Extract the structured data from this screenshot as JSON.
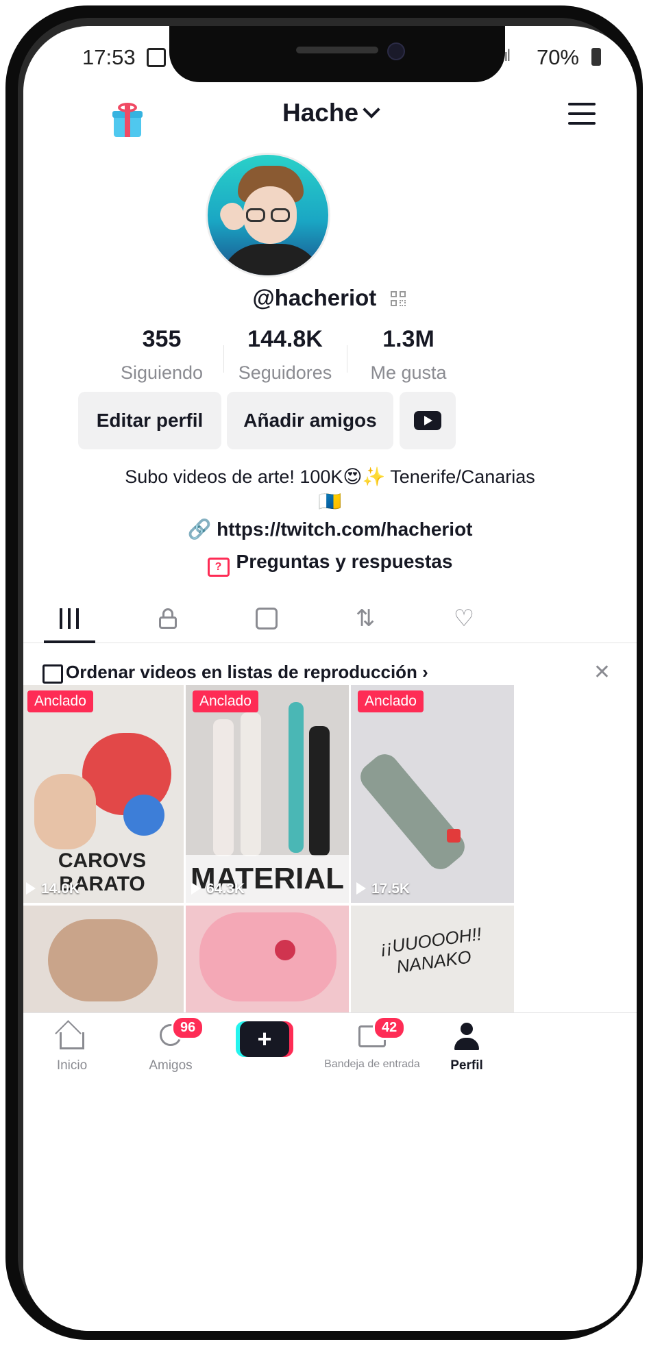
{
  "status_bar": {
    "time": "17:53",
    "battery": "70%",
    "signal": "·ıl"
  },
  "header": {
    "username_title": "Hache"
  },
  "profile": {
    "handle": "@hacheriot",
    "stats": [
      {
        "value": "355",
        "label": "Siguiendo"
      },
      {
        "value": "144.8K",
        "label": "Seguidores"
      },
      {
        "value": "1.3M",
        "label": "Me gusta"
      }
    ],
    "buttons": {
      "edit": "Editar perfil",
      "add_friends": "Añadir amigos"
    },
    "bio_line1": "Subo videos de arte! 100K😍✨ Tenerife/Canarias",
    "bio_line2": "🇮🇨",
    "link": "https://twitch.com/hacheriot",
    "qa": "Preguntas y respuestas"
  },
  "playlist_banner": "Ordenar videos en listas de reproducción",
  "videos": [
    {
      "badge": "Anclado",
      "views": "14.0K",
      "caption": "CAROVS BARATO",
      "bg": "#e9e6e2"
    },
    {
      "badge": "Anclado",
      "views": "64.3K",
      "caption": "MATERIAL",
      "bg": "#d7d4d2"
    },
    {
      "badge": "Anclado",
      "views": "17.5K",
      "caption": "",
      "bg": "#dddce0"
    },
    {
      "badge": "",
      "views": "",
      "caption": "",
      "bg": "#e4dcd6"
    },
    {
      "badge": "",
      "views": "",
      "caption": "",
      "bg": "#f2c6cc"
    },
    {
      "badge": "",
      "views": "",
      "caption": "¡¡UUOOOH!! NANAKO",
      "bg": "#ebe9e6"
    }
  ],
  "bottom_nav": {
    "home": "Inicio",
    "friends": "Amigos",
    "friends_badge": "96",
    "create": "+",
    "inbox": "Bandeja de entrada",
    "inbox_badge": "42",
    "profile": "Perfil"
  },
  "colors": {
    "accent": "#fe2c55",
    "cyan": "#25f4ee",
    "text": "#161823",
    "muted": "#8a8b91"
  }
}
